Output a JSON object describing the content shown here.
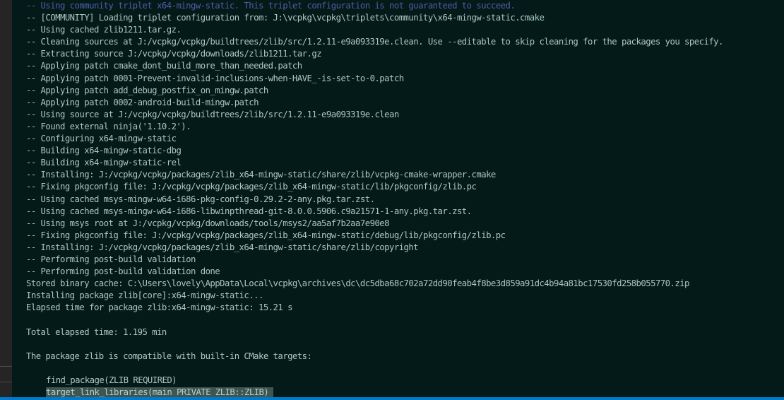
{
  "terminal": {
    "lines": [
      {
        "text": "-- Using community triplet x64-mingw-static. This triplet configuration is not guaranteed to succeed.",
        "kind": "info"
      },
      {
        "text": "-- [COMMUNITY] Loading triplet configuration from: J:\\vcpkg\\vcpkg\\triplets\\community\\x64-mingw-static.cmake",
        "kind": "normal"
      },
      {
        "text": "-- Using cached zlib1211.tar.gz.",
        "kind": "normal"
      },
      {
        "text": "-- Cleaning sources at J:/vcpkg/vcpkg/buildtrees/zlib/src/1.2.11-e9a093319e.clean. Use --editable to skip cleaning for the packages you specify.",
        "kind": "normal"
      },
      {
        "text": "-- Extracting source J:/vcpkg/vcpkg/downloads/zlib1211.tar.gz",
        "kind": "normal"
      },
      {
        "text": "-- Applying patch cmake_dont_build_more_than_needed.patch",
        "kind": "normal"
      },
      {
        "text": "-- Applying patch 0001-Prevent-invalid-inclusions-when-HAVE_-is-set-to-0.patch",
        "kind": "normal"
      },
      {
        "text": "-- Applying patch add_debug_postfix_on_mingw.patch",
        "kind": "normal"
      },
      {
        "text": "-- Applying patch 0002-android-build-mingw.patch",
        "kind": "normal"
      },
      {
        "text": "-- Using source at J:/vcpkg/vcpkg/buildtrees/zlib/src/1.2.11-e9a093319e.clean",
        "kind": "normal"
      },
      {
        "text": "-- Found external ninja('1.10.2').",
        "kind": "normal"
      },
      {
        "text": "-- Configuring x64-mingw-static",
        "kind": "normal"
      },
      {
        "text": "-- Building x64-mingw-static-dbg",
        "kind": "normal"
      },
      {
        "text": "-- Building x64-mingw-static-rel",
        "kind": "normal"
      },
      {
        "text": "-- Installing: J:/vcpkg/vcpkg/packages/zlib_x64-mingw-static/share/zlib/vcpkg-cmake-wrapper.cmake",
        "kind": "normal"
      },
      {
        "text": "-- Fixing pkgconfig file: J:/vcpkg/vcpkg/packages/zlib_x64-mingw-static/lib/pkgconfig/zlib.pc",
        "kind": "normal"
      },
      {
        "text": "-- Using cached msys-mingw-w64-i686-pkg-config-0.29.2-2-any.pkg.tar.zst.",
        "kind": "normal"
      },
      {
        "text": "-- Using cached msys-mingw-w64-i686-libwinpthread-git-8.0.0.5906.c9a21571-1-any.pkg.tar.zst.",
        "kind": "normal"
      },
      {
        "text": "-- Using msys root at J:/vcpkg/vcpkg/downloads/tools/msys2/aa5af7b2aa7e90e8",
        "kind": "normal"
      },
      {
        "text": "-- Fixing pkgconfig file: J:/vcpkg/vcpkg/packages/zlib_x64-mingw-static/debug/lib/pkgconfig/zlib.pc",
        "kind": "normal"
      },
      {
        "text": "-- Installing: J:/vcpkg/vcpkg/packages/zlib_x64-mingw-static/share/zlib/copyright",
        "kind": "normal"
      },
      {
        "text": "-- Performing post-build validation",
        "kind": "normal"
      },
      {
        "text": "-- Performing post-build validation done",
        "kind": "normal"
      },
      {
        "text": "Stored binary cache: C:\\Users\\lovely\\AppData\\Local\\vcpkg\\archives\\dc\\dc5dba68c702a72dd90feab4f8be3d859a91dc4b94a81bc17530fd258b055770.zip",
        "kind": "normal"
      },
      {
        "text": "Installing package zlib[core]:x64-mingw-static...",
        "kind": "normal"
      },
      {
        "text": "Elapsed time for package zlib:x64-mingw-static: 15.21 s",
        "kind": "normal"
      },
      {
        "text": "",
        "kind": "normal"
      },
      {
        "text": "Total elapsed time: 1.195 min",
        "kind": "normal"
      },
      {
        "text": "",
        "kind": "normal"
      },
      {
        "text": "The package zlib is compatible with built-in CMake targets:",
        "kind": "normal"
      },
      {
        "text": "",
        "kind": "normal"
      },
      {
        "text": "find_package(ZLIB REQUIRED)",
        "kind": "indent"
      },
      {
        "text": "target_link_libraries(main PRIVATE ZLIB::ZLIB) ",
        "kind": "indent-selected"
      }
    ]
  },
  "colors": {
    "background": "#041a18",
    "text": "#a9c7bf",
    "info_text": "#4a5fa8",
    "selection": "#3e5551",
    "status_bar": "#007acc"
  }
}
